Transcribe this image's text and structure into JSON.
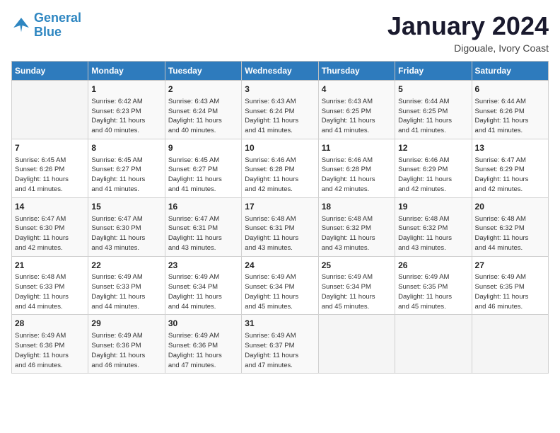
{
  "logo": {
    "line1": "General",
    "line2": "Blue"
  },
  "title": "January 2024",
  "subtitle": "Digouale, Ivory Coast",
  "days_header": [
    "Sunday",
    "Monday",
    "Tuesday",
    "Wednesday",
    "Thursday",
    "Friday",
    "Saturday"
  ],
  "weeks": [
    [
      {
        "day": "",
        "info": ""
      },
      {
        "day": "1",
        "info": "Sunrise: 6:42 AM\nSunset: 6:23 PM\nDaylight: 11 hours\nand 40 minutes."
      },
      {
        "day": "2",
        "info": "Sunrise: 6:43 AM\nSunset: 6:24 PM\nDaylight: 11 hours\nand 40 minutes."
      },
      {
        "day": "3",
        "info": "Sunrise: 6:43 AM\nSunset: 6:24 PM\nDaylight: 11 hours\nand 41 minutes."
      },
      {
        "day": "4",
        "info": "Sunrise: 6:43 AM\nSunset: 6:25 PM\nDaylight: 11 hours\nand 41 minutes."
      },
      {
        "day": "5",
        "info": "Sunrise: 6:44 AM\nSunset: 6:25 PM\nDaylight: 11 hours\nand 41 minutes."
      },
      {
        "day": "6",
        "info": "Sunrise: 6:44 AM\nSunset: 6:26 PM\nDaylight: 11 hours\nand 41 minutes."
      }
    ],
    [
      {
        "day": "7",
        "info": "Sunrise: 6:45 AM\nSunset: 6:26 PM\nDaylight: 11 hours\nand 41 minutes."
      },
      {
        "day": "8",
        "info": "Sunrise: 6:45 AM\nSunset: 6:27 PM\nDaylight: 11 hours\nand 41 minutes."
      },
      {
        "day": "9",
        "info": "Sunrise: 6:45 AM\nSunset: 6:27 PM\nDaylight: 11 hours\nand 41 minutes."
      },
      {
        "day": "10",
        "info": "Sunrise: 6:46 AM\nSunset: 6:28 PM\nDaylight: 11 hours\nand 42 minutes."
      },
      {
        "day": "11",
        "info": "Sunrise: 6:46 AM\nSunset: 6:28 PM\nDaylight: 11 hours\nand 42 minutes."
      },
      {
        "day": "12",
        "info": "Sunrise: 6:46 AM\nSunset: 6:29 PM\nDaylight: 11 hours\nand 42 minutes."
      },
      {
        "day": "13",
        "info": "Sunrise: 6:47 AM\nSunset: 6:29 PM\nDaylight: 11 hours\nand 42 minutes."
      }
    ],
    [
      {
        "day": "14",
        "info": "Sunrise: 6:47 AM\nSunset: 6:30 PM\nDaylight: 11 hours\nand 42 minutes."
      },
      {
        "day": "15",
        "info": "Sunrise: 6:47 AM\nSunset: 6:30 PM\nDaylight: 11 hours\nand 43 minutes."
      },
      {
        "day": "16",
        "info": "Sunrise: 6:47 AM\nSunset: 6:31 PM\nDaylight: 11 hours\nand 43 minutes."
      },
      {
        "day": "17",
        "info": "Sunrise: 6:48 AM\nSunset: 6:31 PM\nDaylight: 11 hours\nand 43 minutes."
      },
      {
        "day": "18",
        "info": "Sunrise: 6:48 AM\nSunset: 6:32 PM\nDaylight: 11 hours\nand 43 minutes."
      },
      {
        "day": "19",
        "info": "Sunrise: 6:48 AM\nSunset: 6:32 PM\nDaylight: 11 hours\nand 43 minutes."
      },
      {
        "day": "20",
        "info": "Sunrise: 6:48 AM\nSunset: 6:32 PM\nDaylight: 11 hours\nand 44 minutes."
      }
    ],
    [
      {
        "day": "21",
        "info": "Sunrise: 6:48 AM\nSunset: 6:33 PM\nDaylight: 11 hours\nand 44 minutes."
      },
      {
        "day": "22",
        "info": "Sunrise: 6:49 AM\nSunset: 6:33 PM\nDaylight: 11 hours\nand 44 minutes."
      },
      {
        "day": "23",
        "info": "Sunrise: 6:49 AM\nSunset: 6:34 PM\nDaylight: 11 hours\nand 44 minutes."
      },
      {
        "day": "24",
        "info": "Sunrise: 6:49 AM\nSunset: 6:34 PM\nDaylight: 11 hours\nand 45 minutes."
      },
      {
        "day": "25",
        "info": "Sunrise: 6:49 AM\nSunset: 6:34 PM\nDaylight: 11 hours\nand 45 minutes."
      },
      {
        "day": "26",
        "info": "Sunrise: 6:49 AM\nSunset: 6:35 PM\nDaylight: 11 hours\nand 45 minutes."
      },
      {
        "day": "27",
        "info": "Sunrise: 6:49 AM\nSunset: 6:35 PM\nDaylight: 11 hours\nand 46 minutes."
      }
    ],
    [
      {
        "day": "28",
        "info": "Sunrise: 6:49 AM\nSunset: 6:36 PM\nDaylight: 11 hours\nand 46 minutes."
      },
      {
        "day": "29",
        "info": "Sunrise: 6:49 AM\nSunset: 6:36 PM\nDaylight: 11 hours\nand 46 minutes."
      },
      {
        "day": "30",
        "info": "Sunrise: 6:49 AM\nSunset: 6:36 PM\nDaylight: 11 hours\nand 47 minutes."
      },
      {
        "day": "31",
        "info": "Sunrise: 6:49 AM\nSunset: 6:37 PM\nDaylight: 11 hours\nand 47 minutes."
      },
      {
        "day": "",
        "info": ""
      },
      {
        "day": "",
        "info": ""
      },
      {
        "day": "",
        "info": ""
      }
    ]
  ]
}
